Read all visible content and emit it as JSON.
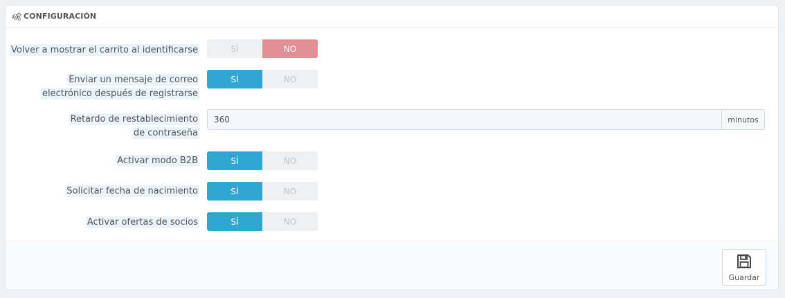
{
  "panel": {
    "title": "CONFIGURACIÓN"
  },
  "fields": [
    {
      "label": "Volver a mostrar el carrito al identificarse",
      "yes": "SÍ",
      "no": "NO",
      "value": "no"
    },
    {
      "label": "Enviar un mensaje de correo electrónico después de registrarse",
      "yes": "SÍ",
      "no": "NO",
      "value": "yes"
    },
    {
      "label": "Retardo de restablecimiento de contraseña",
      "input_value": "360",
      "suffix": "minutos"
    },
    {
      "label": "Activar modo B2B",
      "yes": "SÍ",
      "no": "NO",
      "value": "yes"
    },
    {
      "label": "Solicitar fecha de nacimiento",
      "yes": "SÍ",
      "no": "NO",
      "value": "yes"
    },
    {
      "label": "Activar ofertas de socios",
      "yes": "SÍ",
      "no": "NO",
      "value": "yes"
    }
  ],
  "footer": {
    "save_label": "Guardar"
  },
  "colors": {
    "yes_active": "#2ea8d3",
    "no_active": "#e08f94"
  },
  "icons": {
    "heading": "gears-icon",
    "save": "floppy-disk-icon"
  }
}
